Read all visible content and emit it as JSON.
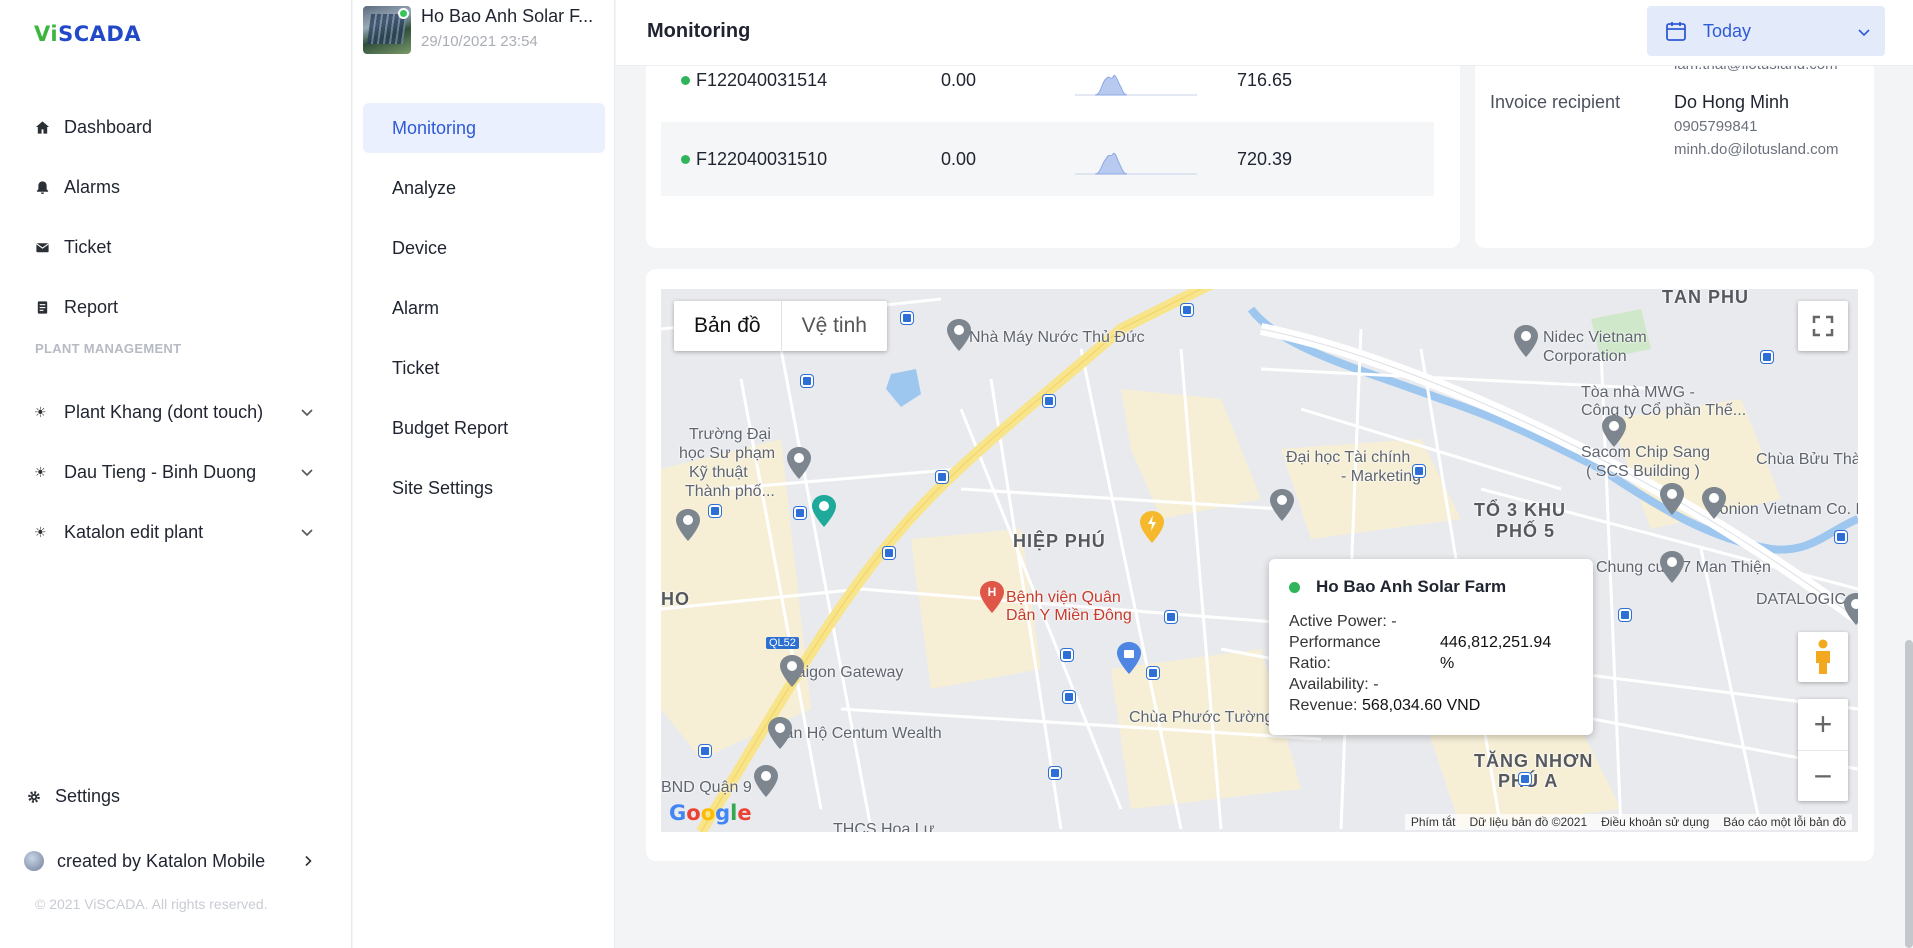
{
  "app": {
    "logo_text_v": "Vi",
    "logo_text_rest": "SCADA"
  },
  "sidebar": {
    "items": [
      {
        "label": "Dashboard",
        "icon": "home-icon"
      },
      {
        "label": "Alarms",
        "icon": "bell-icon"
      },
      {
        "label": "Ticket",
        "icon": "mail-icon"
      },
      {
        "label": "Report",
        "icon": "report-icon"
      }
    ],
    "section_title": "PLANT MANAGEMENT",
    "plants": [
      {
        "label": "Plant Khang (dont touch)"
      },
      {
        "label": "Dau Tieng - Binh Duong"
      },
      {
        "label": "Katalon edit plant"
      }
    ],
    "settings_label": "Settings",
    "user_label": "created by Katalon Mobile",
    "copyright": "© 2021 ViSCADA. All rights reserved."
  },
  "plant": {
    "name": "Ho Bao Anh Solar F...",
    "datetime": "29/10/2021 23:54"
  },
  "subnav": {
    "items": [
      {
        "label": "Monitoring",
        "active": true
      },
      {
        "label": "Analyze"
      },
      {
        "label": "Device"
      },
      {
        "label": "Alarm"
      },
      {
        "label": "Ticket"
      },
      {
        "label": "Budget Report"
      },
      {
        "label": "Site Settings"
      }
    ]
  },
  "header": {
    "title": "Monitoring",
    "date_range": "Today"
  },
  "devices": [
    {
      "serial": "F122040031514",
      "power": "0.00",
      "energy": "716.65"
    },
    {
      "serial": "F122040031510",
      "power": "0.00",
      "energy": "720.39"
    }
  ],
  "contact": {
    "email_partial": "lam.thai@ilotusland.com",
    "invoice_label": "Invoice recipient",
    "invoice_name": "Do Hong Minh",
    "invoice_phone": "0905799841",
    "invoice_email": "minh.do@ilotusland.com"
  },
  "map": {
    "type_map": "Bản đồ",
    "type_satellite": "Vệ tinh",
    "labels": {
      "tan_phu": "TÂN PHÚ",
      "nha_may_nuoc": "Nhà Máy Nước Thủ Đức",
      "nidec_1": "Nidec Vietnam",
      "nidec_2": "Corporation",
      "toa_nha_mwg_1": "Tòa nhà MWG -",
      "toa_nha_mwg_2": "Công ty Cổ phần Thế...",
      "truong_dh_1": "Trường Đại",
      "truong_dh_2": "học Sư phạm",
      "truong_dh_3": "Kỹ thuật",
      "truong_dh_4": "Thành phố...",
      "dh_tai_chinh_1": "Đại học Tài chính",
      "dh_tai_chinh_2": "- Marketing",
      "sacom_1": "Sacom Chip Sang",
      "sacom_2": "( SCS Building )",
      "chua_buu_thanh": "Chùa Bửu Thành",
      "sonion": "Sonion Vietnam Co. Ltd",
      "to3_1": "TỔ 3 KHU",
      "to3_2": "PHỐ 5",
      "hiep_phu": "HIỆP PHÚ",
      "chung_cu": "Chung cư C7 Man Thiện",
      "datalogic": "DATALOGIC",
      "benh_vien_1": "Bệnh viện Quân",
      "benh_vien_2": "Dân Y Miền Đông",
      "saigon_gateway": "Saigon Gateway",
      "can_ho": "Căn Hộ Centum Wealth",
      "chua_phuoc": "Chùa Phước Tường",
      "tang_nhon_1": "TĂNG NHƠN",
      "tang_nhon_2": "PHÚ A",
      "bnd": "BND Quận 9",
      "thcs": "THCS Hoa Lư",
      "ho": "HO",
      "ql52": "QL52"
    },
    "attribution": [
      "Phím tắt",
      "Dữ liệu bản đồ ©2021",
      "Điều khoản sử dụng",
      "Báo cáo một lỗi bản đồ"
    ],
    "info": {
      "title": "Ho Bao Anh Solar Farm",
      "active_power": "Active Power: -",
      "pr_label_1": "Performance",
      "pr_label_2": "Ratio:",
      "pr_value": "446,812,251.94",
      "pr_unit": "%",
      "availability": "Availability: -",
      "revenue_label": "Revenue:",
      "revenue_value": "568,034.60 VND"
    }
  }
}
